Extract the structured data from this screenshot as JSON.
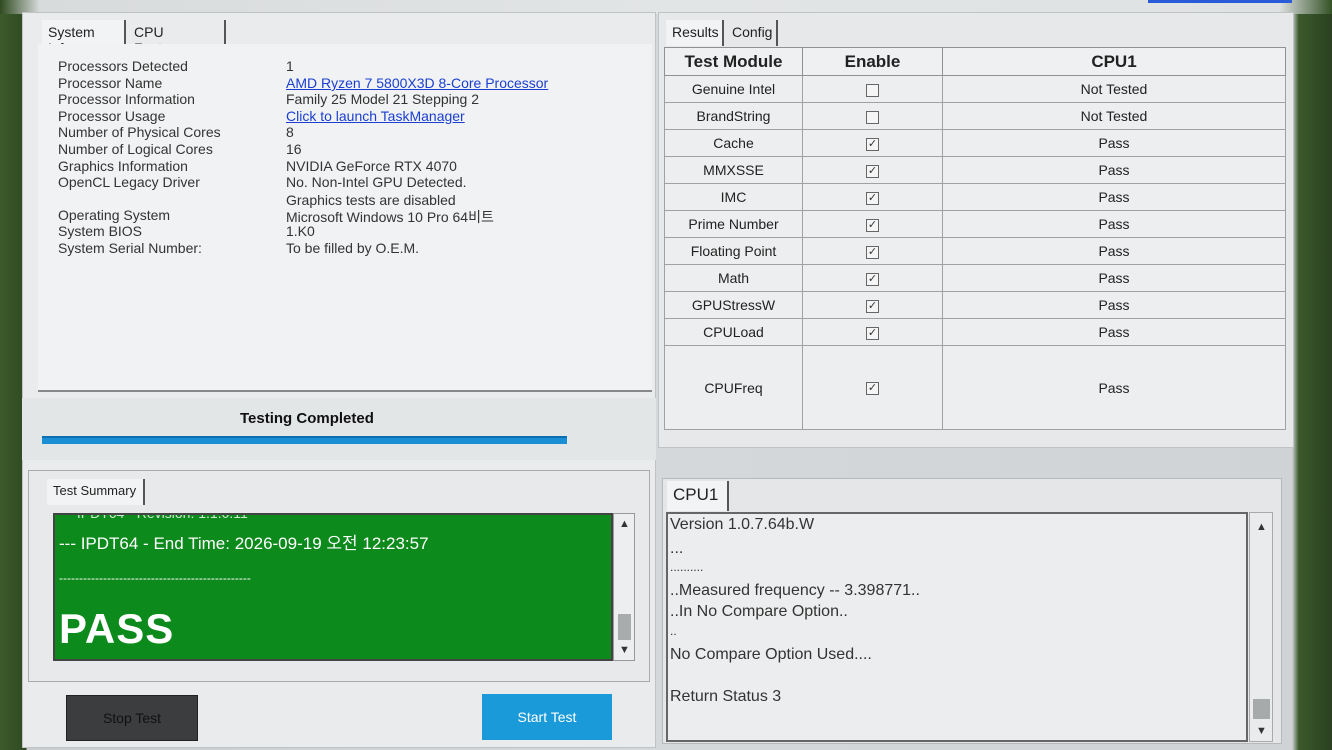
{
  "left_tabs": [
    "System Info",
    "CPU Features"
  ],
  "system_info": [
    {
      "label": "Processors Detected",
      "value": "1",
      "link": false
    },
    {
      "label": "Processor Name",
      "value": "AMD Ryzen 7 5800X3D 8-Core Processor",
      "link": true
    },
    {
      "label": "Processor Information",
      "value": "Family 25 Model 21 Stepping 2",
      "link": false
    },
    {
      "label": "Processor Usage",
      "value": "Click to launch TaskManager",
      "link": true
    },
    {
      "label": "Number of Physical Cores",
      "value": "8",
      "link": false
    },
    {
      "label": "Number of Logical Cores",
      "value": "16",
      "link": false
    },
    {
      "label": "Graphics Information",
      "value": "NVIDIA GeForce RTX 4070",
      "link": false
    },
    {
      "label": "OpenCL Legacy Driver",
      "value": "No. Non-Intel GPU Detected.",
      "link": false
    },
    {
      "label": "",
      "value": "Graphics tests are disabled",
      "link": false
    },
    {
      "label": "Operating System",
      "value": "Microsoft Windows 10 Pro 64비트",
      "link": false
    },
    {
      "label": "System BIOS",
      "value": "1.K0",
      "link": false
    },
    {
      "label": "System Serial Number:",
      "value": "To be filled by O.E.M.",
      "link": false
    }
  ],
  "status": {
    "text": "Testing Completed",
    "progress": 1.0
  },
  "summary": {
    "tab": "Test Summary",
    "lines": [
      "--- IPDT64 - End Time: 2026-09-19 오전 12:23:57",
      "------------------------------------------------"
    ],
    "result": "PASS"
  },
  "buttons": {
    "stop": "Stop Test",
    "start": "Start Test"
  },
  "right_tabs": [
    "Results",
    "Config"
  ],
  "results": {
    "headers": [
      "Test Module",
      "Enable",
      "CPU1"
    ],
    "rows": [
      {
        "module": "Genuine Intel",
        "enabled": false,
        "result": "Not Tested"
      },
      {
        "module": "BrandString",
        "enabled": false,
        "result": "Not Tested"
      },
      {
        "module": "Cache",
        "enabled": true,
        "result": "Pass"
      },
      {
        "module": "MMXSSE",
        "enabled": true,
        "result": "Pass"
      },
      {
        "module": "IMC",
        "enabled": true,
        "result": "Pass"
      },
      {
        "module": "Prime Number",
        "enabled": true,
        "result": "Pass"
      },
      {
        "module": "Floating Point",
        "enabled": true,
        "result": "Pass"
      },
      {
        "module": "Math",
        "enabled": true,
        "result": "Pass"
      },
      {
        "module": "GPUStressW",
        "enabled": true,
        "result": "Pass"
      },
      {
        "module": "CPULoad",
        "enabled": true,
        "result": "Pass"
      },
      {
        "module": "CPUFreq",
        "enabled": true,
        "result": "Pass"
      }
    ]
  },
  "cpu_tab": "CPU1",
  "cpu_log": [
    "Version 1.0.7.64b.W",
    "...",
    "..........",
    "..Measured frequency -- 3.398771..",
    "..In No Compare Option..",
    "..",
    "No Compare Option Used....",
    "",
    "Return Status  3"
  ],
  "colors": {
    "log_green": "#0c8a1b",
    "progress_blue": "#1a8fd6",
    "start_blue": "#1b9ad9",
    "link_blue": "#1a3fd1"
  }
}
